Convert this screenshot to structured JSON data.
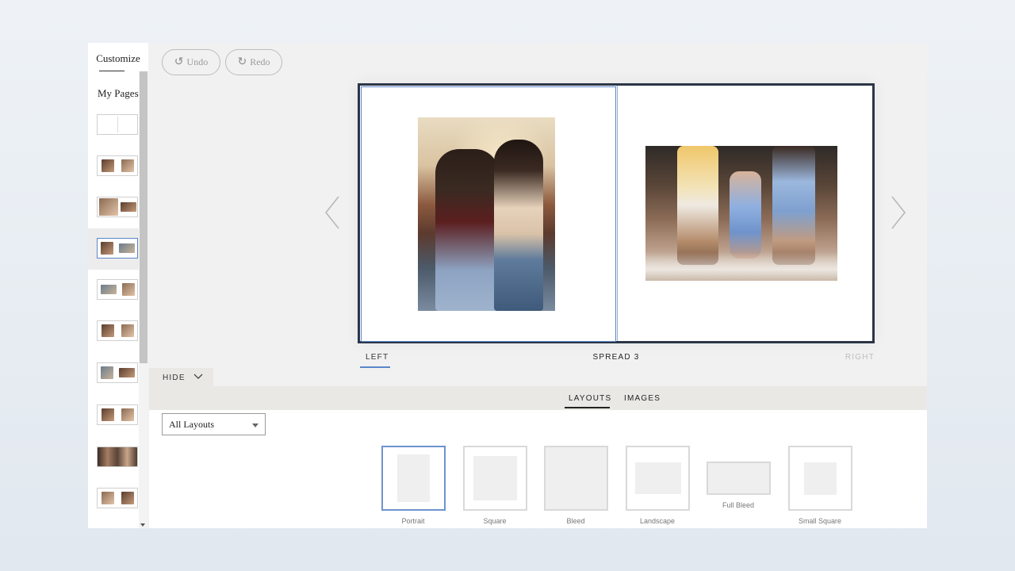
{
  "sidebar": {
    "tab_label": "Customize",
    "heading": "My Pages"
  },
  "toolbar": {
    "undo_label": "Undo",
    "redo_label": "Redo"
  },
  "spread": {
    "left_label": "LEFT",
    "center_label": "SPREAD 3",
    "right_label": "RIGHT"
  },
  "panel": {
    "hide_label": "HIDE",
    "tabs": [
      {
        "label": "LAYOUTS",
        "active": true
      },
      {
        "label": "IMAGES",
        "active": false
      }
    ],
    "filter": {
      "selected": "All Layouts"
    },
    "layouts": [
      {
        "label": "Portrait",
        "selected": true
      },
      {
        "label": "Square",
        "selected": false
      },
      {
        "label": "Bleed",
        "selected": false
      },
      {
        "label": "Landscape",
        "selected": false
      },
      {
        "label": "Full Bleed",
        "selected": false
      },
      {
        "label": "Small Square",
        "selected": false
      }
    ]
  },
  "colors": {
    "accent": "#5a86c9",
    "spread_border": "#2b3547",
    "panel_bar": "#e9e8e4"
  }
}
